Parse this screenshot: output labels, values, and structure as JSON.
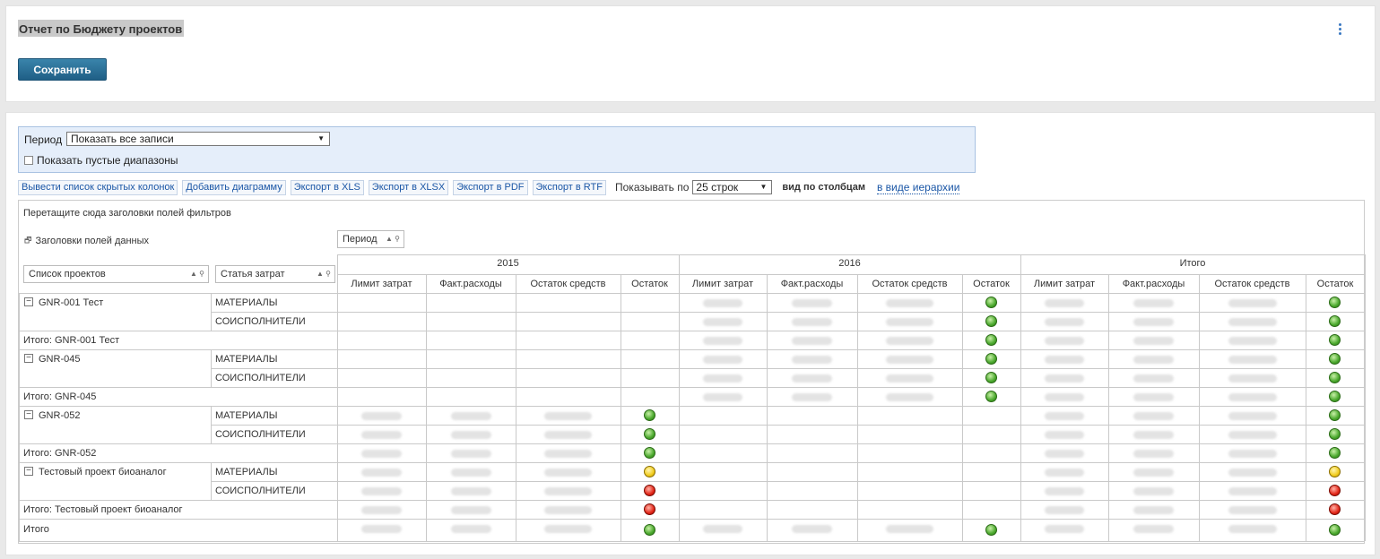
{
  "header": {
    "title": "Отчет по Бюджету проектов",
    "save_label": "Сохранить"
  },
  "filter": {
    "period_label": "Период",
    "period_value": "Показать все записи",
    "show_empty_label": "Показать пустые диапазоны"
  },
  "toolbar": {
    "buttons": [
      "Вывести список скрытых колонок",
      "Добавить диаграмму",
      "Экспорт в XLS",
      "Экспорт в XLSX",
      "Экспорт в PDF",
      "Экспорт в RTF"
    ],
    "show_by_label": "Показывать по",
    "rows_value": "25 строк",
    "view_columns": "вид по столбцам",
    "view_hierarchy": "в виде иерархии"
  },
  "pivot": {
    "drop_filter_hint": "Перетащите сюда заголовки полей фильтров",
    "data_headers_label": "Заголовки полей данных",
    "column_field": "Период",
    "row_fields": [
      "Список проектов",
      "Статья затрат"
    ],
    "years": [
      "2015",
      "2016",
      "Итого"
    ],
    "measures": [
      "Лимит затрат",
      "Факт.расходы",
      "Остаток средств",
      "Остаток"
    ],
    "rows": [
      {
        "project": "GNR-001 Тест",
        "article": "МАТЕРИАЛЫ",
        "kind": "item",
        "status": [
          "",
          "green",
          "green"
        ]
      },
      {
        "project": "",
        "article": "СОИСПОЛНИТЕЛИ",
        "kind": "item",
        "status": [
          "",
          "green",
          "green"
        ]
      },
      {
        "project": "Итого: GNR-001 Тест",
        "article": "",
        "kind": "subtotal",
        "status": [
          "",
          "green",
          "green"
        ]
      },
      {
        "project": "GNR-045",
        "article": "МАТЕРИАЛЫ",
        "kind": "item",
        "status": [
          "",
          "green",
          "green"
        ]
      },
      {
        "project": "",
        "article": "СОИСПОЛНИТЕЛИ",
        "kind": "item",
        "status": [
          "",
          "green",
          "green"
        ]
      },
      {
        "project": "Итого: GNR-045",
        "article": "",
        "kind": "subtotal",
        "status": [
          "",
          "green",
          "green"
        ]
      },
      {
        "project": "GNR-052",
        "article": "МАТЕРИАЛЫ",
        "kind": "item",
        "status": [
          "green",
          "",
          "green"
        ]
      },
      {
        "project": "",
        "article": "СОИСПОЛНИТЕЛИ",
        "kind": "item",
        "status": [
          "green",
          "",
          "green"
        ]
      },
      {
        "project": "Итого: GNR-052",
        "article": "",
        "kind": "subtotal",
        "status": [
          "green",
          "",
          "green"
        ]
      },
      {
        "project": "Тестовый проект биоаналог",
        "article": "МАТЕРИАЛЫ",
        "kind": "item",
        "status": [
          "yellow",
          "",
          "yellow"
        ]
      },
      {
        "project": "",
        "article": "СОИСПОЛНИТЕЛИ",
        "kind": "item",
        "status": [
          "red",
          "",
          "red"
        ]
      },
      {
        "project": "Итого: Тестовый проект биоаналог",
        "article": "",
        "kind": "subtotal",
        "status": [
          "red",
          "",
          "red"
        ]
      },
      {
        "project": "Итого",
        "article": "",
        "kind": "grand",
        "status": [
          "green",
          "green",
          "green"
        ]
      }
    ]
  },
  "colors": {
    "accent": "#1f5f86",
    "link": "#1a56a6",
    "filter_bg": "#e5eefa"
  }
}
